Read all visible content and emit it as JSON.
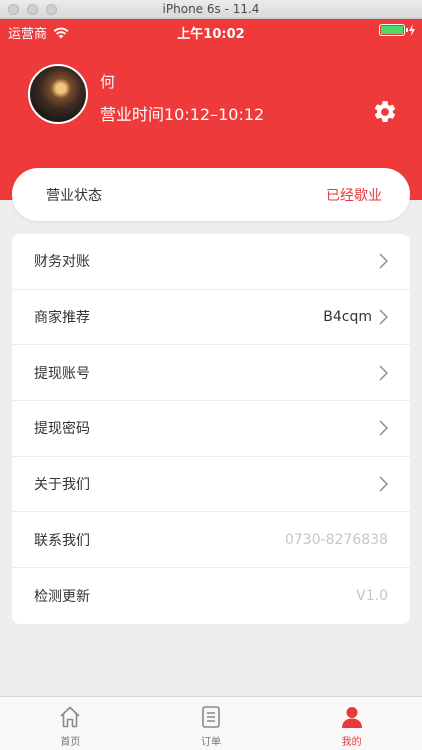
{
  "window": {
    "title": "iPhone 6s - 11.4"
  },
  "status_bar": {
    "carrier": "运营商",
    "time": "上午10:02"
  },
  "profile": {
    "name": "何",
    "hours": "营业时间10:12–10:12"
  },
  "business_status": {
    "label": "营业状态",
    "value": "已经歇业"
  },
  "menu": {
    "items": [
      {
        "label": "财务对账",
        "value": ""
      },
      {
        "label": "商家推荐",
        "value": "B4cqm"
      },
      {
        "label": "提现账号",
        "value": ""
      },
      {
        "label": "提现密码",
        "value": ""
      },
      {
        "label": "关于我们",
        "value": ""
      },
      {
        "label": "联系我们",
        "value": "0730-8276838"
      },
      {
        "label": "检测更新",
        "value": "V1.0"
      }
    ]
  },
  "tabbar": {
    "tabs": [
      {
        "label": "首页",
        "icon": "home-icon"
      },
      {
        "label": "订单",
        "icon": "order-icon"
      },
      {
        "label": "我的",
        "icon": "profile-icon"
      }
    ],
    "active": 2
  },
  "colors": {
    "accent": "#ee3a3a",
    "active_tab": "#e83a3a",
    "muted_text": "#c6c6c6"
  }
}
